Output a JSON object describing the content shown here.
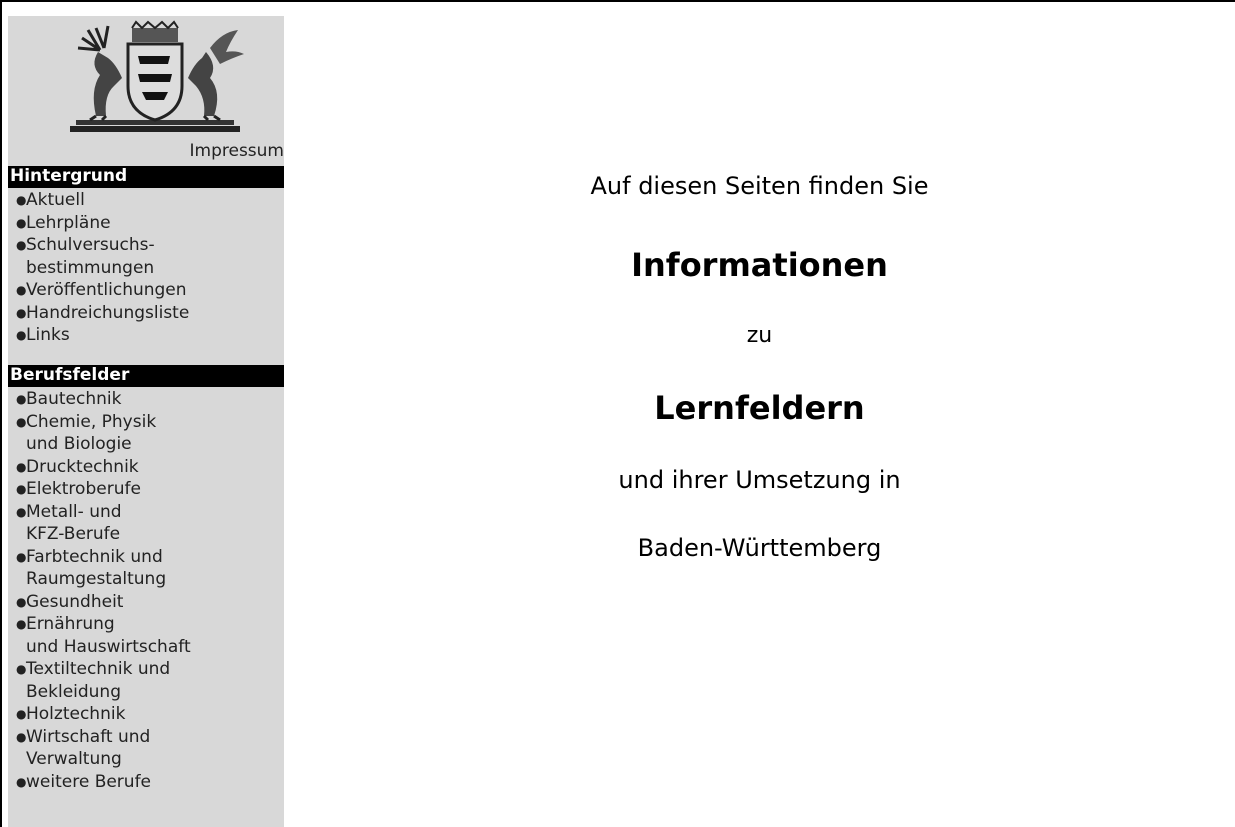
{
  "sidebar": {
    "impressum": "Impressum",
    "sections": [
      {
        "title": "Hintergrund",
        "items": [
          {
            "label": "Aktuell"
          },
          {
            "label": "Lehrpläne"
          },
          {
            "label": "Schulversuchs-",
            "label2": "bestimmungen"
          },
          {
            "label": "Veröffentlichungen"
          },
          {
            "label": "Handreichungsliste"
          },
          {
            "label": "Links"
          }
        ]
      },
      {
        "title": "Berufsfelder",
        "items": [
          {
            "label": "Bautechnik"
          },
          {
            "label": "Chemie, Physik",
            "label2": "und Biologie"
          },
          {
            "label": "Drucktechnik"
          },
          {
            "label": "Elektroberufe"
          },
          {
            "label": "Metall- und",
            "label2": "KFZ-Berufe"
          },
          {
            "label": "Farbtechnik und",
            "label2": "Raumgestaltung"
          },
          {
            "label": "Gesundheit"
          },
          {
            "label": "Ernährung",
            "label2": "und Hauswirtschaft"
          },
          {
            "label": "Textiltechnik und",
            "label2": "Bekleidung"
          },
          {
            "label": "Holztechnik"
          },
          {
            "label": "Wirtschaft und",
            "label2": "Verwaltung"
          },
          {
            "label": "weitere Berufe"
          }
        ]
      }
    ]
  },
  "main": {
    "line1": "Auf diesen Seiten finden Sie",
    "line2": "Informationen",
    "line3": "zu",
    "line4": "Lernfeldern",
    "line5": "und ihrer Umsetzung in",
    "line6": "Baden-Württemberg"
  }
}
